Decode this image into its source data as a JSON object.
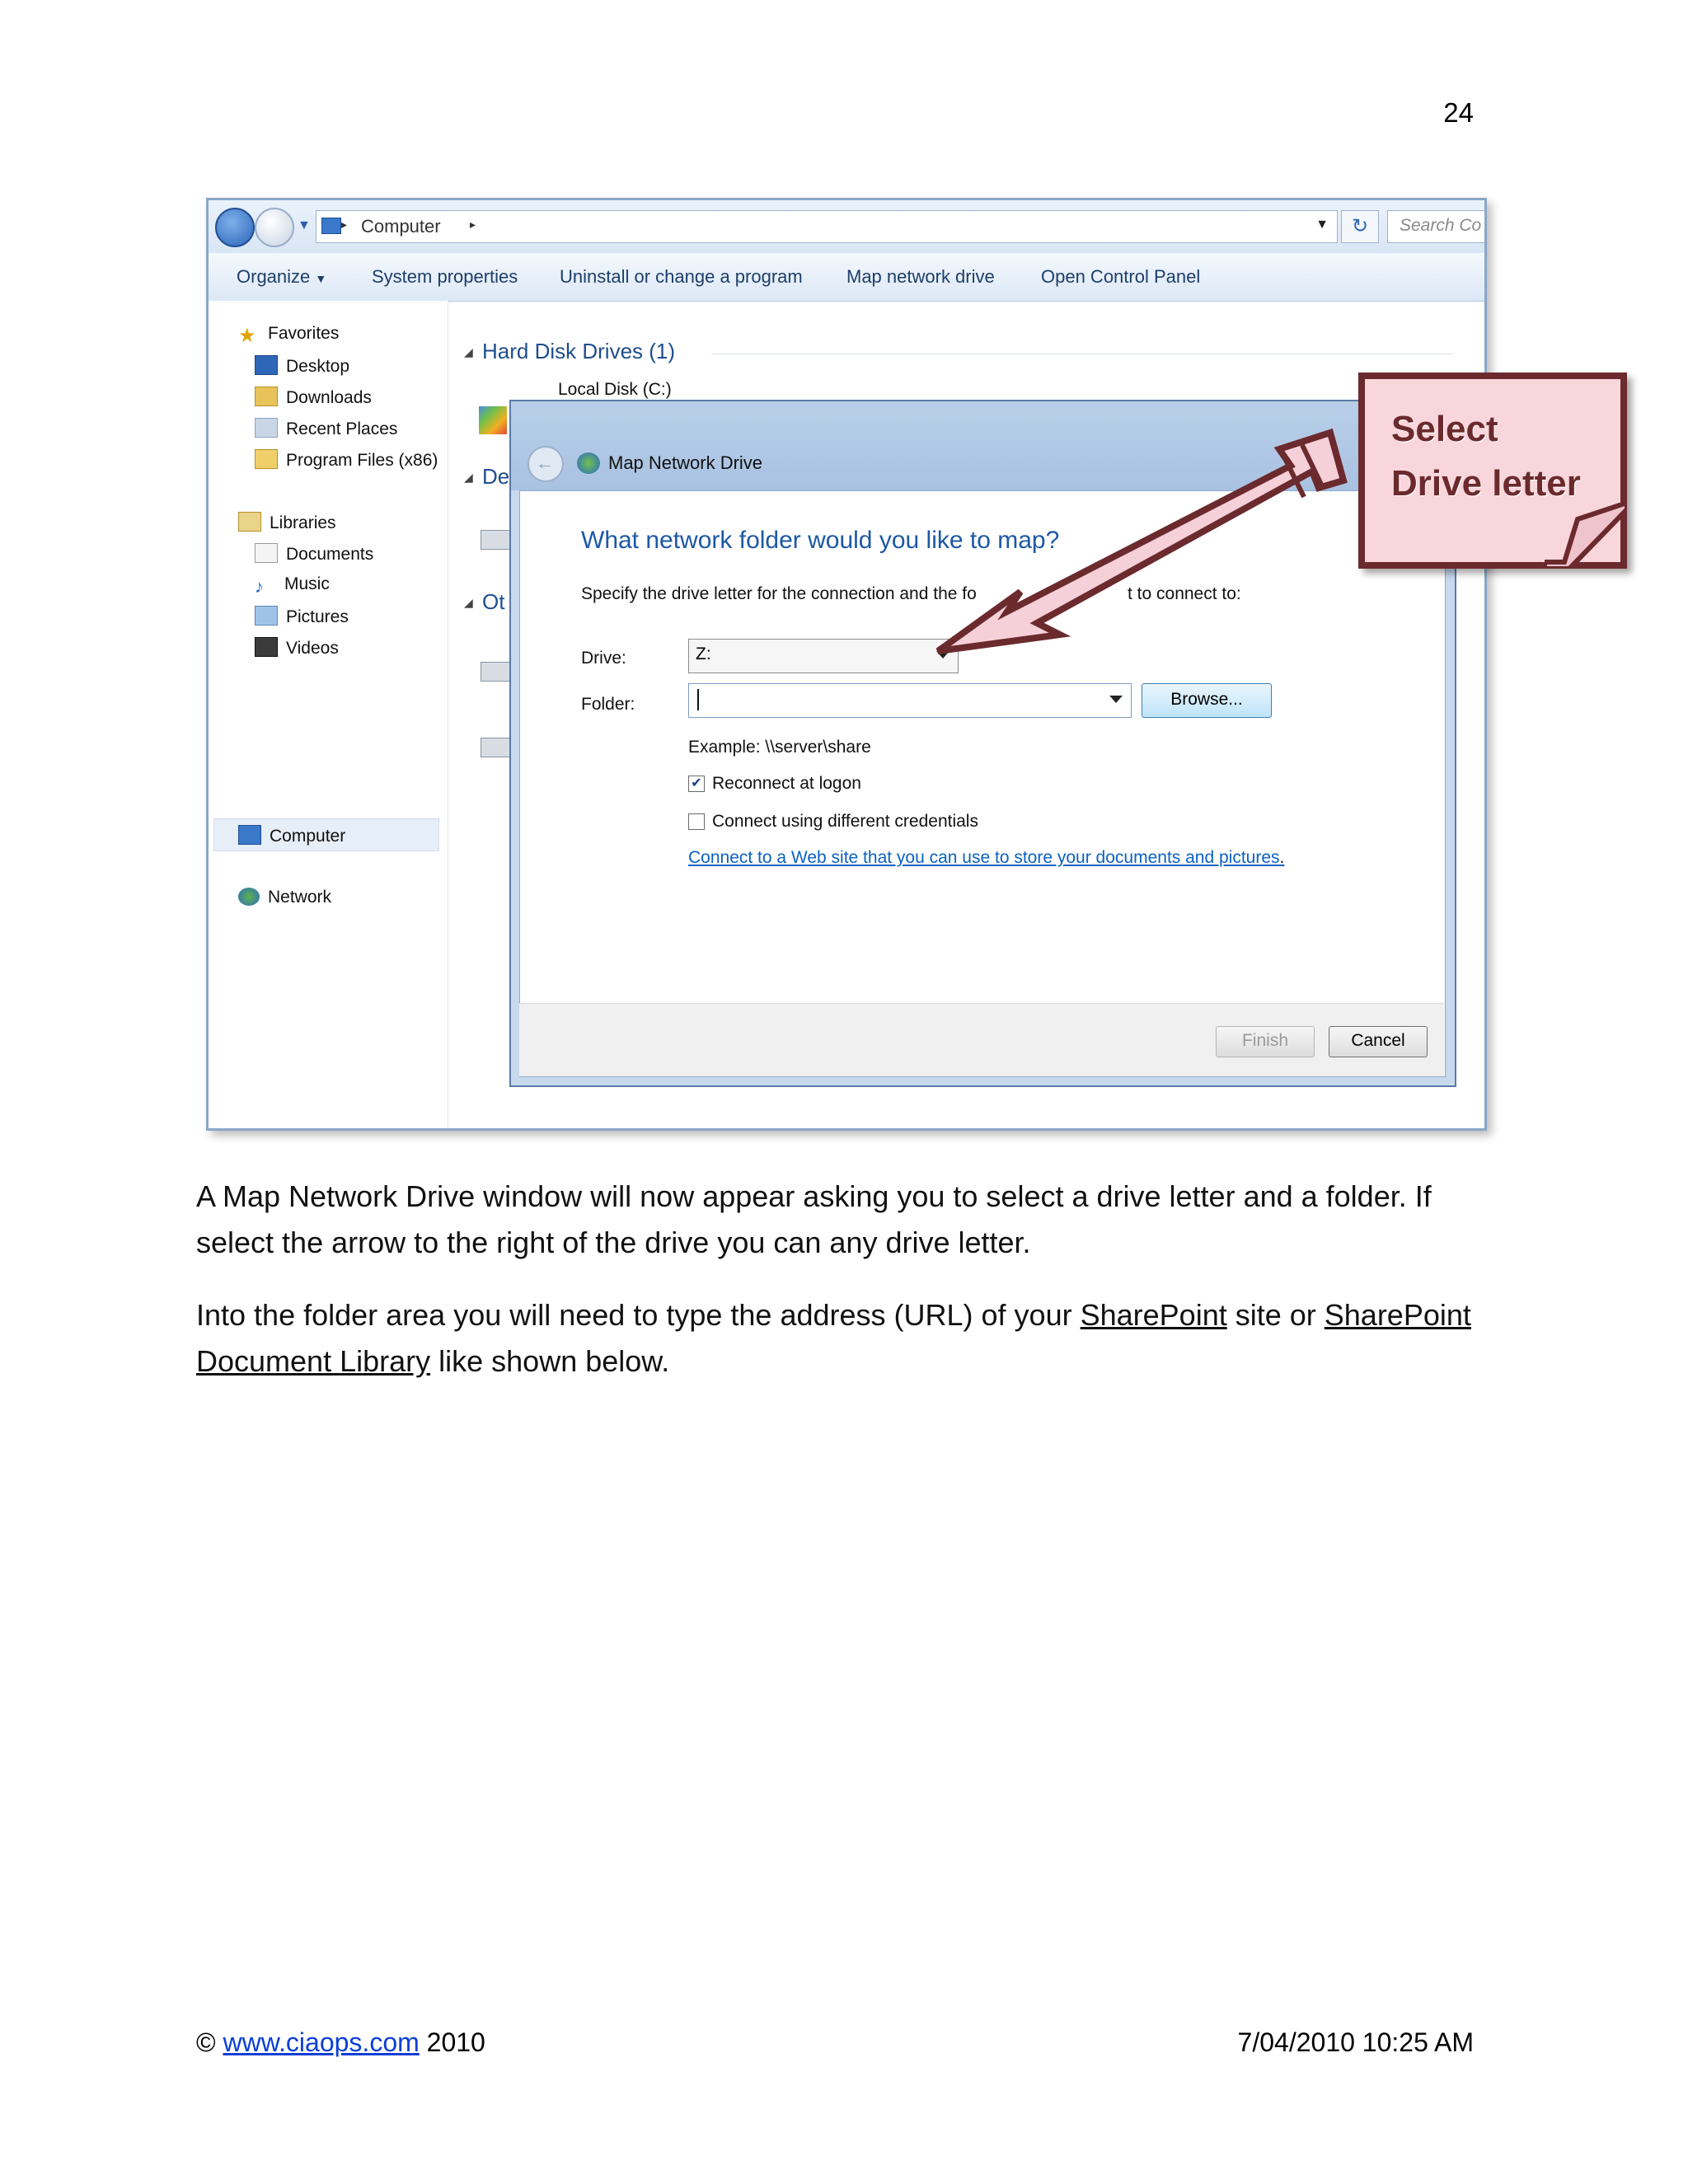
{
  "page": {
    "number": "24"
  },
  "explorer": {
    "breadcrumb": [
      "Computer"
    ],
    "search_placeholder": "Search Co",
    "toolbar": [
      "Organize",
      "System properties",
      "Uninstall or change a program",
      "Map network drive",
      "Open Control Panel"
    ],
    "nav": {
      "favorites": "Favorites",
      "favorites_items": [
        "Desktop",
        "Downloads",
        "Recent Places",
        "Program Files (x86)"
      ],
      "libraries": "Libraries",
      "libraries_items": [
        "Documents",
        "Music",
        "Pictures",
        "Videos"
      ],
      "computer": "Computer",
      "network": "Network"
    },
    "content": {
      "hard_disk_header": "Hard Disk Drives (1)",
      "local_disk": "Local Disk (C:)",
      "devices_header_partial": "De",
      "other_header_partial": "Ot"
    }
  },
  "dialog": {
    "title": "Map Network Drive",
    "heading": "What network folder would you like to map?",
    "subtitle_left": "Specify the drive letter for the connection and the fo",
    "subtitle_right": "t to connect to:",
    "drive_label": "Drive:",
    "drive_value": "Z:",
    "folder_label": "Folder:",
    "folder_value": "",
    "browse_label": "Browse...",
    "example": "Example: \\\\server\\share",
    "reconnect_label": "Reconnect at logon",
    "reconnect_checked": true,
    "credentials_label": "Connect using different credentials",
    "credentials_checked": false,
    "link_text": "Connect to a Web site that you can use to store your documents and pictures",
    "finish_label": "Finish",
    "cancel_label": "Cancel"
  },
  "callout": {
    "line1": "Select",
    "line2": "Drive letter"
  },
  "body": {
    "p1": "A Map Network Drive window will now appear asking you to select a drive letter and a folder. If select the arrow to the right of the drive you can any drive letter.",
    "p2_a": "Into the folder area you will need to type the address (URL) of your ",
    "p2_sharepoint1": "SharePoint",
    "p2_b": " site or ",
    "p2_sharepoint2": "SharePoint",
    "p2_c": " ",
    "p2_doclib": "Document Library",
    "p2_d": " like shown below."
  },
  "footer": {
    "copyright": "©",
    "site": "www.ciaops.com",
    "year": "2010",
    "date": "7/04/2010 10:25 AM"
  }
}
